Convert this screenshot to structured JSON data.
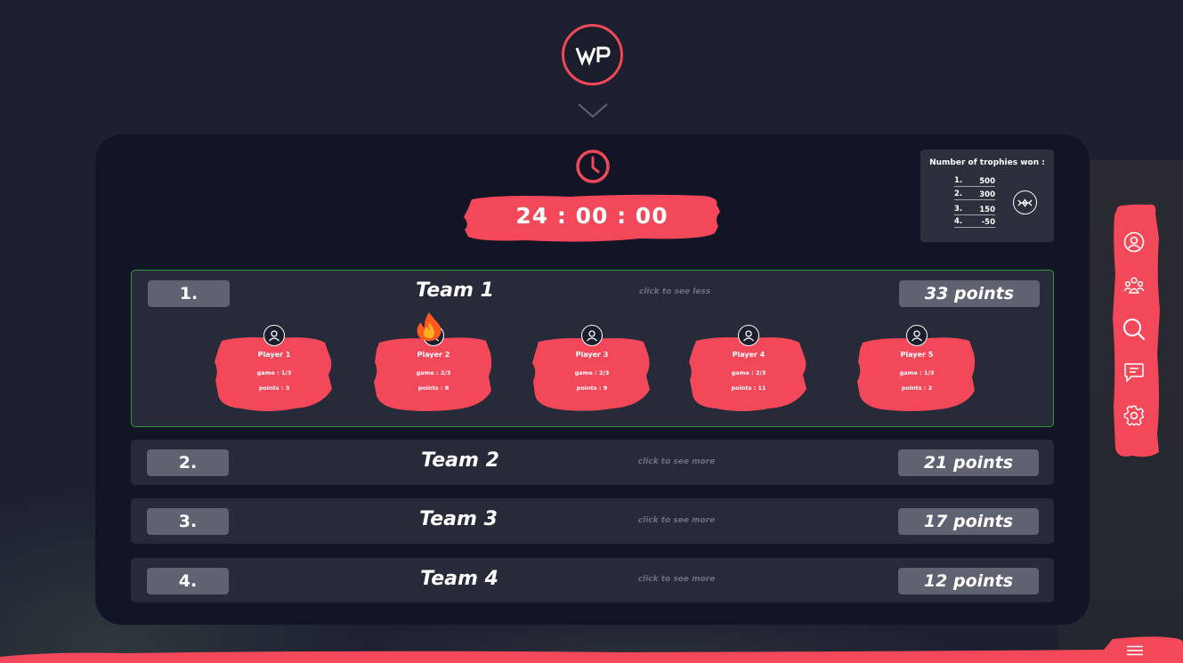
{
  "brand": {
    "logo_text": "WP"
  },
  "timer": {
    "value": "24 : 00 : 00"
  },
  "trophies": {
    "title": "Number of trophies won :",
    "rows": [
      {
        "rank": "1.",
        "value": "500"
      },
      {
        "rank": "2.",
        "value": "300"
      },
      {
        "rank": "3.",
        "value": "150"
      },
      {
        "rank": "4.",
        "value": "-50"
      }
    ]
  },
  "teams": [
    {
      "rank": "1.",
      "name": "Team 1",
      "toggle": "click to see less",
      "points": "33 points",
      "players": [
        {
          "name": "Player 1",
          "game": "game : 1/3",
          "points": "points : 3"
        },
        {
          "name": "Player 2",
          "game": "game : 2/3",
          "points": "points : 8"
        },
        {
          "name": "Player 3",
          "game": "game : 2/3",
          "points": "points : 9"
        },
        {
          "name": "Player 4",
          "game": "game : 2/3",
          "points": "points : 11"
        },
        {
          "name": "Player 5",
          "game": "game : 1/3",
          "points": "points : 2"
        }
      ]
    },
    {
      "rank": "2.",
      "name": "Team 2",
      "toggle": "click to see more",
      "points": "21 points"
    },
    {
      "rank": "3.",
      "name": "Team 3",
      "toggle": "click to see more",
      "points": "17 points"
    },
    {
      "rank": "4.",
      "name": "Team 4",
      "toggle": "click to see more",
      "points": "12 points"
    }
  ],
  "side_menu": [
    "profile-icon",
    "team-icon",
    "search-icon",
    "chat-icon",
    "settings-icon"
  ],
  "colors": {
    "accent": "#f2485a",
    "background": "#1d2030",
    "panel": "#111525",
    "row": "#272a38",
    "badge": "#5f6270",
    "expanded_border": "#2f9a33"
  }
}
